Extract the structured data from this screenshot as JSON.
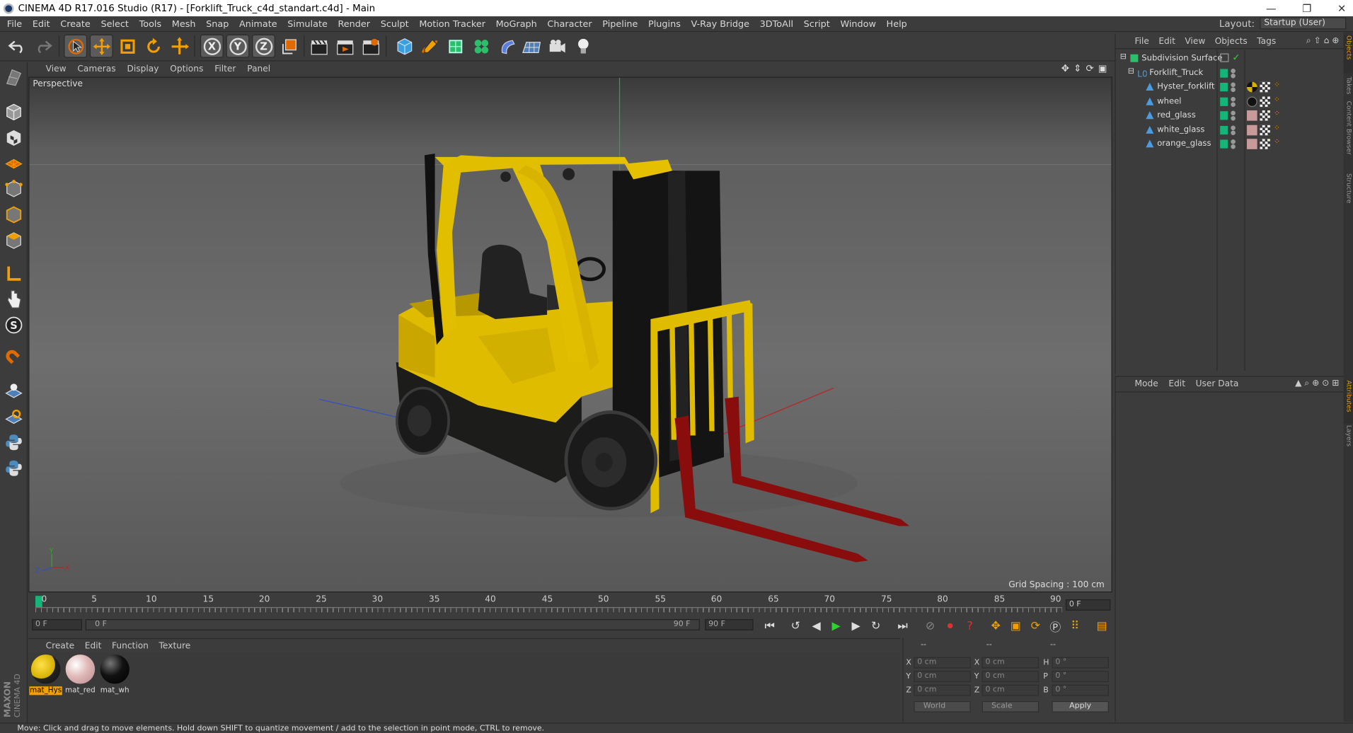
{
  "window": {
    "title": "CINEMA 4D R17.016 Studio (R17) - [Forklift_Truck_c4d_standart.c4d] - Main",
    "controls": [
      "—",
      "❐",
      "✕"
    ]
  },
  "menubar": {
    "items": [
      "File",
      "Edit",
      "Create",
      "Select",
      "Tools",
      "Mesh",
      "Snap",
      "Animate",
      "Simulate",
      "Render",
      "Sculpt",
      "Motion Tracker",
      "MoGraph",
      "Character",
      "Pipeline",
      "Plugins",
      "V-Ray Bridge",
      "3DToAll",
      "Script",
      "Window",
      "Help"
    ],
    "layout_label": "Layout:",
    "layout_value": "Startup (User)"
  },
  "toolbar": {
    "axis_x": "X",
    "axis_y": "Y",
    "axis_z": "Z"
  },
  "viewport": {
    "menu": [
      "View",
      "Cameras",
      "Display",
      "Options",
      "Filter",
      "Panel"
    ],
    "label": "Perspective",
    "grid_spacing": "Grid Spacing : 100 cm",
    "axis_y": "Y",
    "axis_x": "X",
    "axis_z": "Z"
  },
  "timeline": {
    "ticks": [
      "0",
      "5",
      "10",
      "15",
      "20",
      "25",
      "30",
      "35",
      "40",
      "45",
      "50",
      "55",
      "60",
      "65",
      "70",
      "75",
      "80",
      "85",
      "90"
    ],
    "current_frame": "0 F",
    "start_field": "0 F",
    "range_start": "0 F",
    "range_end": "90 F",
    "end_field": "90 F"
  },
  "materials": {
    "menu": [
      "Create",
      "Edit",
      "Function",
      "Texture"
    ],
    "items": [
      {
        "label": "mat_Hys",
        "selected": true,
        "color": "#d6b000"
      },
      {
        "label": "mat_red",
        "selected": false,
        "color": "#e0b8b8"
      },
      {
        "label": "mat_wh",
        "selected": false,
        "color": "#111111"
      }
    ]
  },
  "coordinates": {
    "headers": [
      "--",
      "--",
      "--"
    ],
    "rows": [
      {
        "a": "X",
        "av": "0 cm",
        "b": "X",
        "bv": "0 cm",
        "c": "H",
        "cv": "0 °"
      },
      {
        "a": "Y",
        "av": "0 cm",
        "b": "Y",
        "bv": "0 cm",
        "c": "P",
        "cv": "0 °"
      },
      {
        "a": "Z",
        "av": "0 cm",
        "b": "Z",
        "bv": "0 cm",
        "c": "B",
        "cv": "0 °"
      }
    ],
    "space": "World",
    "mode": "Scale",
    "apply": "Apply"
  },
  "objects": {
    "menu": [
      "File",
      "Edit",
      "View",
      "Objects",
      "Tags"
    ],
    "items": [
      {
        "name": "Subdivision Surface",
        "depth": 0
      },
      {
        "name": "Forklift_Truck",
        "depth": 1
      },
      {
        "name": "Hyster_forklift",
        "depth": 2
      },
      {
        "name": "wheel",
        "depth": 2
      },
      {
        "name": "red_glass",
        "depth": 2
      },
      {
        "name": "white_glass",
        "depth": 2
      },
      {
        "name": "orange_glass",
        "depth": 2
      }
    ]
  },
  "attributes": {
    "menu": [
      "Mode",
      "Edit",
      "User Data"
    ]
  },
  "sidetabs": [
    "Objects",
    "Takes",
    "Content Browser",
    "Structure",
    "Attributes",
    "Layers"
  ],
  "status": "Move: Click and drag to move elements. Hold down SHIFT to quantize movement / add to the selection in point mode, CTRL to remove.",
  "brand": {
    "line1": "MAXON",
    "line2": "CINEMA 4D"
  }
}
